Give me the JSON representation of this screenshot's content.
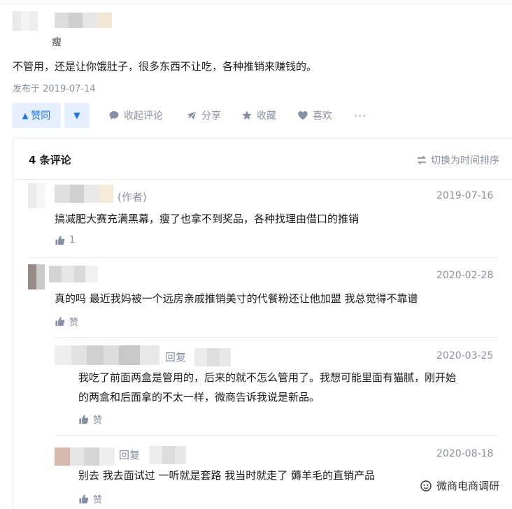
{
  "answer": {
    "author_tag": "瘦",
    "text": "不管用，还是让你饿肚子，很多东西不让吃，各种推销来赚钱的。",
    "published": "发布于 2019-07-14"
  },
  "actions": {
    "upvote_label": "赞同",
    "collapse_label": "收起评论",
    "share_label": "分享",
    "favorite_label": "收藏",
    "like_label": "喜欢",
    "more_label": "···"
  },
  "comments": {
    "count_label": "4 条评论",
    "sort_label": "切换为时间排序",
    "items": [
      {
        "author_suffix": "(作者)",
        "date": "2019-07-16",
        "text": "搞减肥大赛充满黑幕，瘦了也拿不到奖品，各种找理由借口的推销",
        "likes": "1"
      },
      {
        "date": "2020-02-28",
        "text": "真的吗 最近我妈被一个远房亲戚推销美寸的代餐粉还让他加盟 我总觉得不靠谱",
        "likes": "赞"
      },
      {
        "reply_word": "回复",
        "date": "2020-03-25",
        "text_line1": "我吃了前面两盒是管用的，后来的就不怎么管用了。我想可能里面有猫腻，刚开始",
        "text_line2": "的两盒和后面拿的不太一样，微商告诉我说是新品。",
        "likes": "赞"
      },
      {
        "reply_word": "回复",
        "date": "2020-08-18",
        "text": "别去 我去面试过 一听就是套路 我当时就走了 薅羊毛的直销产品",
        "likes": "赞"
      }
    ]
  },
  "watermark": {
    "text": "微商电商调研"
  },
  "colors": {
    "accent": "#1772f6",
    "accent_bg": "#e5efff",
    "muted": "#8590a6",
    "divider": "#ebebeb"
  }
}
